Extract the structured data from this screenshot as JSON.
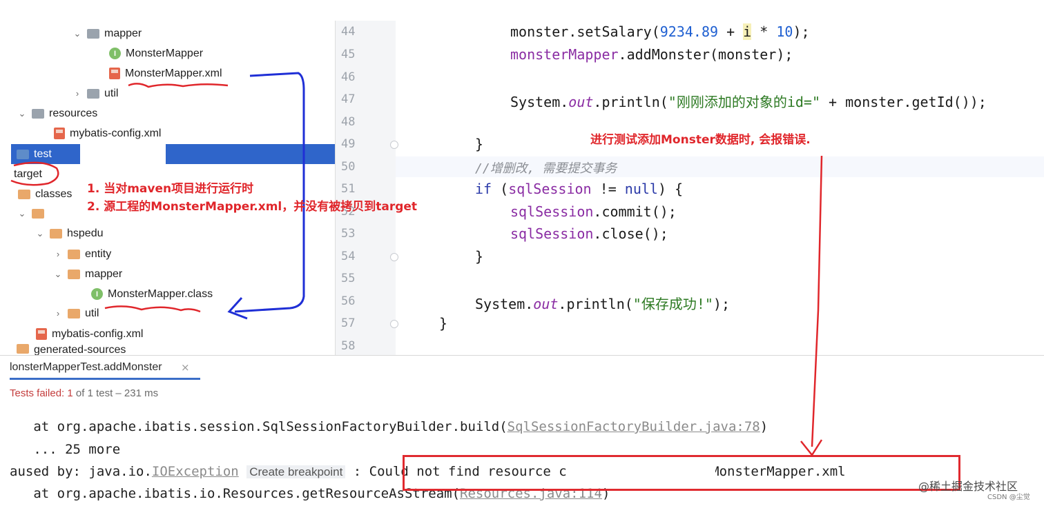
{
  "tree": {
    "items": [
      {
        "label": "mapper"
      },
      {
        "label": "MonsterMapper",
        "badge": "I"
      },
      {
        "label": "MonsterMapper.xml"
      },
      {
        "label": "util"
      },
      {
        "label": "resources"
      },
      {
        "label": "mybatis-config.xml"
      },
      {
        "label": "test"
      },
      {
        "label": "target"
      },
      {
        "label": "classes"
      },
      {
        "label": "hspedu"
      },
      {
        "label": "entity"
      },
      {
        "label": "mapper"
      },
      {
        "label": "MonsterMapper.class",
        "badge": "I"
      },
      {
        "label": "util"
      },
      {
        "label": "mybatis-config.xml"
      },
      {
        "label": "generated-sources"
      }
    ]
  },
  "editor": {
    "line_numbers": [
      "44",
      "45",
      "46",
      "47",
      "48",
      "49",
      "50",
      "51",
      "52",
      "53",
      "54",
      "55",
      "56",
      "57",
      "58"
    ],
    "code": {
      "l44a": "monster.setSalary(",
      "l44num": "9234.89",
      "l44b": " + ",
      "l44i": "i",
      "l44c": " * ",
      "l44num2": "10",
      "l44d": ");",
      "l45a": "monsterMapper",
      "l45b": ".addMonster(monster);",
      "l47a": "System.",
      "l47out": "out",
      "l47b": ".println(",
      "l47str": "\"刚刚添加的对象的id=\"",
      "l47c": " + monster.getId());",
      "l49": "}",
      "l50": "//增删改, 需要提交事务",
      "l51kw": "if",
      "l51a": " (",
      "l51fld": "sqlSession",
      "l51b": " != ",
      "l51null": "null",
      "l51c": ") {",
      "l52fld": "sqlSession",
      "l52": ".commit();",
      "l53fld": "sqlSession",
      "l53": ".close();",
      "l54": "}",
      "l56a": "System.",
      "l56out": "out",
      "l56b": ".println(",
      "l56str": "\"保存成功!\"",
      "l56c": ");",
      "l57": "}"
    }
  },
  "annotations": {
    "note1": "1. 当对maven项目进行运行时",
    "note2": "2. 源工程的MonsterMapper.xml，并没有被拷贝到target",
    "note3": "进行测试添加Monster数据时, 会报错误."
  },
  "run": {
    "tab_label": "lonsterMapperTest.addMonster",
    "close": "×",
    "status_failed": "Tests failed: 1",
    "status_rest": " of 1 test – 231 ms",
    "line1_prefix": "   at org.apache.ibatis.session.SqlSessionFactoryBuilder.build(",
    "line1_link": "SqlSessionFactoryBuilder.java:78",
    "line1_suffix": ")",
    "line2": "   ... 25 more",
    "line3_prefix": "aused by: java.io.",
    "line3_link": "IOException",
    "line3_bp": "Create breakpoint",
    "line3_mid": " : Could not find resource c",
    "line3_end": "/mapper/MonsterMapper.xml",
    "line4_prefix": "   at org.apache.ibatis.io.Resources.getResourceAsStream(",
    "line4_link": "Resources.java:114",
    "line4_suffix": ")"
  },
  "watermark": {
    "main": "@稀土掘金技术社区",
    "sub": "CSDN @尘觉"
  },
  "colors": {
    "annotation_red": "#e0262b",
    "annotation_blue": "#1f2fd6",
    "selection_blue": "#2f65ca"
  }
}
